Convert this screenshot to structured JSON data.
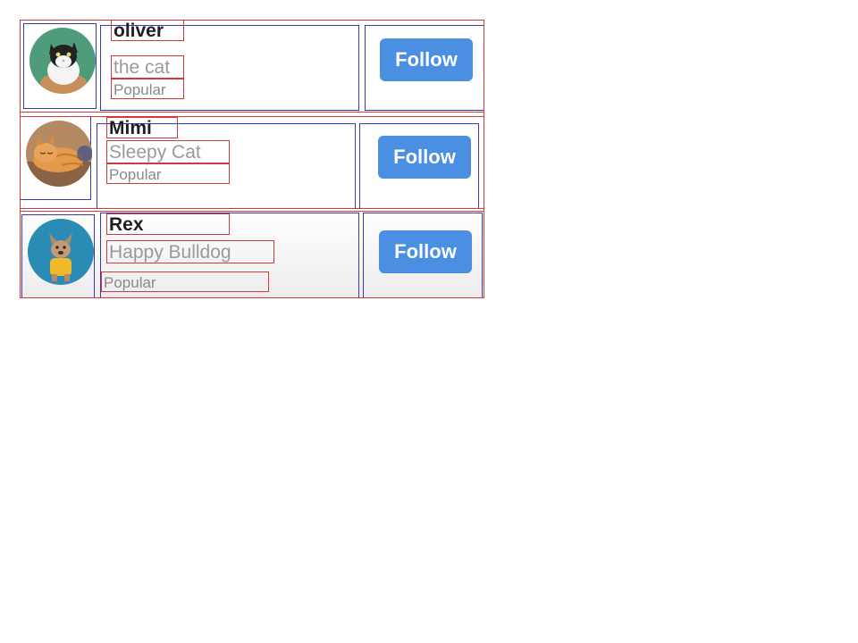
{
  "accent_color": "#4a8fe2",
  "profiles": [
    {
      "name": "oliver",
      "subtitle": "the cat",
      "badge": "Popular",
      "avatar": {
        "icon": "tuxedo-cat-avatar",
        "bg": "#4f9c7a"
      },
      "follow_label": "Follow"
    },
    {
      "name": "Mimi",
      "subtitle": "Sleepy Cat",
      "badge": "Popular",
      "avatar": {
        "icon": "orange-cat-avatar",
        "bg": "#c9a382"
      },
      "follow_label": "Follow"
    },
    {
      "name": "Rex",
      "subtitle": "Happy Bulldog",
      "badge": "Popular",
      "avatar": {
        "icon": "bulldog-avatar",
        "bg": "#2a8bb4"
      },
      "follow_label": "Follow"
    }
  ]
}
